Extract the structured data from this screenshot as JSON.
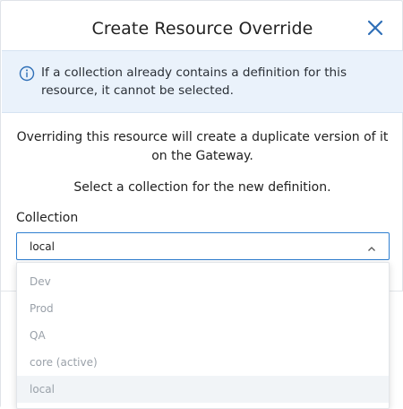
{
  "dialog": {
    "title": "Create Resource Override",
    "close_icon": "close-icon"
  },
  "info_banner": {
    "icon": "info-icon",
    "text": "If a collection already contains a definition for this resource, it cannot be selected."
  },
  "body": {
    "description": "Overriding this resource will create a duplicate version of it on the Gateway.",
    "instruction": "Select a collection for the new definition."
  },
  "collection_field": {
    "label": "Collection",
    "selected_value": "local",
    "chevron_icon": "chevron-up-icon",
    "options": [
      "Dev",
      "Prod",
      "QA",
      "core (active)",
      "local"
    ]
  },
  "colors": {
    "accent": "#2f7fd1",
    "banner_bg": "#eaf2fb",
    "disabled_text": "#9aa1a9"
  }
}
